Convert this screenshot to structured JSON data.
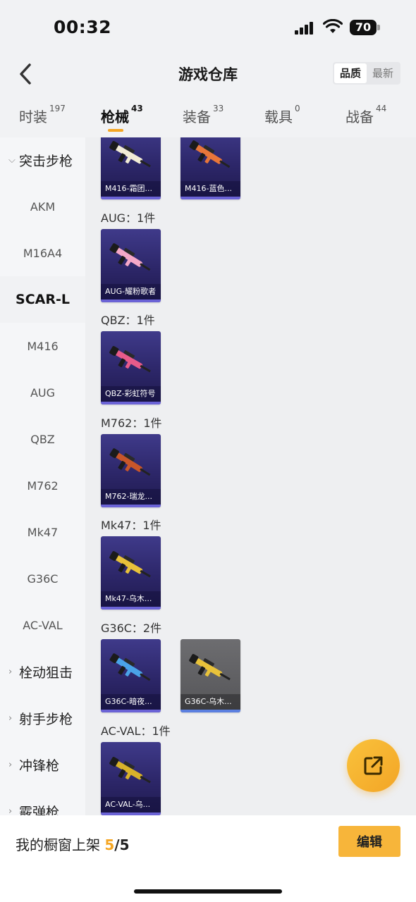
{
  "status_bar": {
    "time": "00:32",
    "battery": "70"
  },
  "nav": {
    "title": "游戏仓库",
    "sort_options": [
      "品质",
      "最新"
    ],
    "sort_active": "品质"
  },
  "tabs": [
    {
      "label": "时装",
      "count": "197"
    },
    {
      "label": "枪械",
      "count": "43"
    },
    {
      "label": "装备",
      "count": "33"
    },
    {
      "label": "载具",
      "count": "0"
    },
    {
      "label": "战备",
      "count": "44"
    }
  ],
  "active_tab": "枪械",
  "sidebar": {
    "items": [
      {
        "label": "突击步枪",
        "type": "group",
        "expanded": true
      },
      {
        "label": "AKM"
      },
      {
        "label": "M16A4"
      },
      {
        "label": "SCAR-L",
        "active": true
      },
      {
        "label": "M416"
      },
      {
        "label": "AUG"
      },
      {
        "label": "QBZ"
      },
      {
        "label": "M762"
      },
      {
        "label": "Mk47"
      },
      {
        "label": "G36C"
      },
      {
        "label": "AC-VAL"
      },
      {
        "label": "栓动狙击",
        "type": "group",
        "expanded": false
      },
      {
        "label": "射手步枪",
        "type": "group",
        "expanded": false
      },
      {
        "label": "冲锋枪",
        "type": "group",
        "expanded": false
      },
      {
        "label": "霰弹枪",
        "type": "group",
        "expanded": false
      }
    ]
  },
  "content": {
    "sections": [
      {
        "label": "",
        "items": [
          {
            "name": "M416-霜团...",
            "color": "#f2ecd6"
          },
          {
            "name": "M416-蓝色...",
            "color": "#e8763a"
          }
        ]
      },
      {
        "label": "AUG：1件",
        "items": [
          {
            "name": "AUG-耀粉歌者",
            "color": "#f5a8c8"
          }
        ]
      },
      {
        "label": "QBZ：1件",
        "items": [
          {
            "name": "QBZ-彩虹符号",
            "color": "#e85b8a"
          }
        ]
      },
      {
        "label": "M762：1件",
        "items": [
          {
            "name": "M762-瑞龙...",
            "color": "#c8562a"
          }
        ]
      },
      {
        "label": "Mk47：1件",
        "items": [
          {
            "name": "Mk47-乌木...",
            "color": "#e8c23a"
          }
        ]
      },
      {
        "label": "G36C：2件",
        "items": [
          {
            "name": "G36C-暗夜...",
            "color": "#4aa3e8"
          },
          {
            "name": "G36C-乌木...",
            "color": "#e8c23a"
          }
        ]
      },
      {
        "label": "AC-VAL：1件",
        "items": [
          {
            "name": "AC-VAL-乌...",
            "color": "#d8b22a"
          }
        ]
      }
    ]
  },
  "bottom_bar": {
    "label": "我的橱窗上架",
    "count": "5",
    "total": "/5",
    "edit_label": "编辑"
  },
  "icons": {
    "back": "chevron-left-icon",
    "fab": "share-icon"
  },
  "colors": {
    "accent": "#f5a623",
    "card_bg": "#2c2668"
  }
}
